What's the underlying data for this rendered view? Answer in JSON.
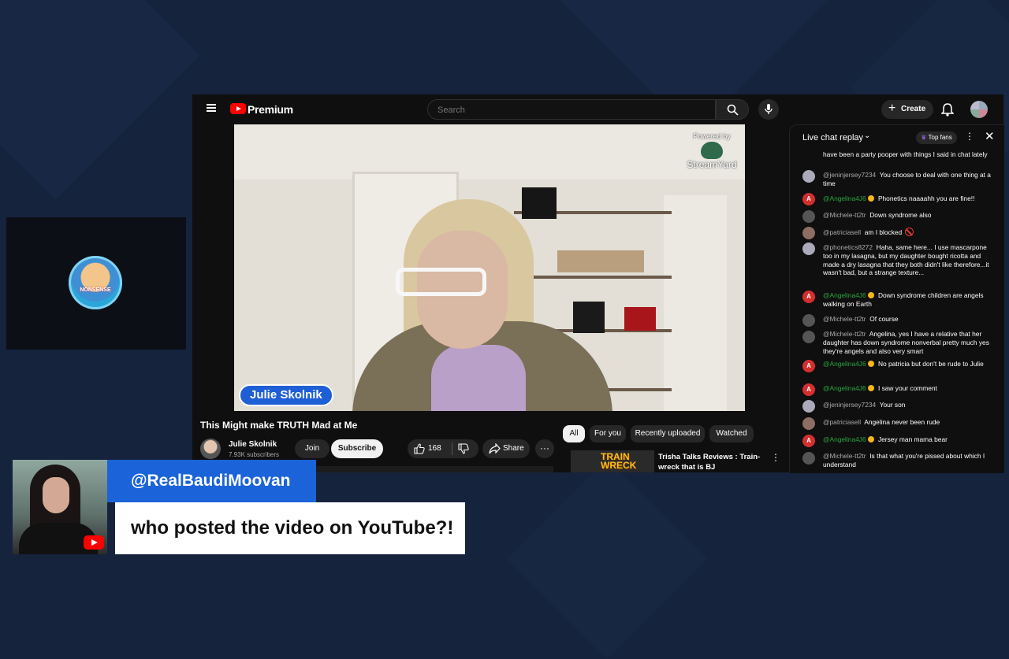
{
  "youtube": {
    "brand": "Premium",
    "search_placeholder": "Search",
    "create_label": "Create"
  },
  "video": {
    "overlay_powered": "Powered by",
    "overlay_brand": "StreamYard",
    "name_tag": "Julie Skolnik",
    "title": "This Might make TRUTH Mad at Me",
    "channel_name": "Julie Skolnik",
    "subscribers": "7.93K subscribers",
    "join_label": "Join",
    "subscribe_label": "Subscribe",
    "like_count": "168",
    "share_label": "Share",
    "more_label": "···"
  },
  "recommendations": {
    "chips": [
      "All",
      "For you",
      "Recently uploaded",
      "Watched"
    ],
    "active_chip": "All",
    "items": [
      {
        "thumb_text": "TRAIN WRECK",
        "title": "Trisha Talks Reviews : Train-wreck that is BJ"
      }
    ]
  },
  "chat": {
    "title": "Live chat replay",
    "top_fans": "Top fans",
    "messages": [
      {
        "author": "",
        "text": "have been a party pooper with things I said in chat lately"
      },
      {
        "author": "@jeninjersey7234",
        "text": "You choose to deal with one thing at a time"
      },
      {
        "author": "@Angelina4J6",
        "text": "Phonetics naaaahh you are fine!!"
      },
      {
        "author": "@Michele-tt2tr",
        "text": "Down syndrome also"
      },
      {
        "author": "@patriciasell",
        "text": "am I blocked"
      },
      {
        "author": "@phonetics8272",
        "text": "Haha, same here... I use mascarpone too in my lasagna, but my daughter bought ricotta and made a dry lasagna that they both didn't like therefore...it wasn't bad, but a strange texture..."
      },
      {
        "author": "@Angelina4J6",
        "text": "Down syndrome children are angels walking on Earth"
      },
      {
        "author": "@Michele-tt2tr",
        "text": "Of course"
      },
      {
        "author": "@Michele-tt2tr",
        "text": "Angelina, yes I have a relative that her daughter has down syndrome nonverbal pretty much yes they're angels and also very smart"
      },
      {
        "author": "@Angelina4J6",
        "text": "No patricia but don't be rude to Julie"
      },
      {
        "author": "@Angelina4J6",
        "text": "I saw your comment"
      },
      {
        "author": "@jeninjersey7234",
        "text": "Your son"
      },
      {
        "author": "@patriciasell",
        "text": "Angelina never been rude"
      },
      {
        "author": "@Angelina4J6",
        "text": "Jersey man mama bear"
      },
      {
        "author": "@Michele-tt2tr",
        "text": "Is that what you're pissed about which I understand"
      }
    ]
  },
  "overlay": {
    "guest_logo_text": "NONSENSE",
    "handle": "@RealBaudiMoovan",
    "caption": "who posted the video on YouTube?!"
  },
  "colors": {
    "background": "#15233d",
    "handle_bar": "#1b63d8",
    "youtube_red": "#ff0000",
    "member_green": "#2ba640"
  }
}
